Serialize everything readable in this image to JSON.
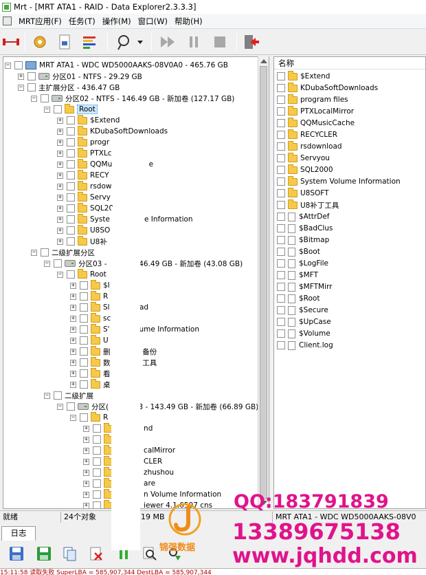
{
  "window": {
    "title": "Mrt - [MRT ATA1 - RAID - Data Explorer2.3.3.3]"
  },
  "menu": [
    {
      "name": "menu-mrt-app",
      "label": "MRT应用(F)"
    },
    {
      "name": "menu-task",
      "label": "任务(T)"
    },
    {
      "name": "menu-action",
      "label": "操作(M)"
    },
    {
      "name": "menu-window",
      "label": "窗口(W)"
    },
    {
      "name": "menu-help",
      "label": "帮助(H)"
    }
  ],
  "tree": [
    {
      "level": 0,
      "exp": "−",
      "icon": "pc",
      "label": "MRT ATA1 - WDC WD5000AAKS-08V0A0 - 465.76 GB"
    },
    {
      "level": 1,
      "exp": "+",
      "icon": "disk",
      "label": "分区01 - NTFS - 29.29 GB"
    },
    {
      "level": 1,
      "exp": "−",
      "icon": "none",
      "label": "主扩展分区 - 436.47 GB"
    },
    {
      "level": 2,
      "exp": "−",
      "icon": "disk",
      "label": "分区02 - NTFS - 146.49 GB - 新加卷 (127.17 GB)"
    },
    {
      "level": 3,
      "exp": "−",
      "icon": "folder",
      "label": "Root",
      "selected": true
    },
    {
      "level": 4,
      "exp": "+",
      "icon": "folder",
      "label": "$Extend"
    },
    {
      "level": 4,
      "exp": "+",
      "icon": "folder",
      "label": "KDubaSoftDownloads"
    },
    {
      "level": 4,
      "exp": "+",
      "icon": "folder",
      "label": "progr"
    },
    {
      "level": 4,
      "exp": "+",
      "icon": "folder",
      "label": "PTXLc"
    },
    {
      "level": 4,
      "exp": "+",
      "icon": "folder",
      "label": "QQMu                e"
    },
    {
      "level": 4,
      "exp": "+",
      "icon": "folder",
      "label": "RECY"
    },
    {
      "level": 4,
      "exp": "+",
      "icon": "folder",
      "label": "rsdow"
    },
    {
      "level": 4,
      "exp": "+",
      "icon": "folder",
      "label": "Servy"
    },
    {
      "level": 4,
      "exp": "+",
      "icon": "folder",
      "label": "SQL20"
    },
    {
      "level": 4,
      "exp": "+",
      "icon": "folder",
      "label": "Syste               e Information"
    },
    {
      "level": 4,
      "exp": "+",
      "icon": "folder",
      "label": "U8SO"
    },
    {
      "level": 4,
      "exp": "+",
      "icon": "folder",
      "label": "U8补"
    },
    {
      "level": 2,
      "exp": "−",
      "icon": "none",
      "label": "二级扩展分区"
    },
    {
      "level": 3,
      "exp": "−",
      "icon": "disk",
      "label": "分区03 -              46.49 GB - 新加卷 (43.08 GB)"
    },
    {
      "level": 4,
      "exp": "−",
      "icon": "folder",
      "label": "Root"
    },
    {
      "level": 5,
      "exp": "+",
      "icon": "folder",
      "label": "$I"
    },
    {
      "level": 5,
      "exp": "+",
      "icon": "folder",
      "label": "R"
    },
    {
      "level": 5,
      "exp": "+",
      "icon": "folder",
      "label": "Sl             ad"
    },
    {
      "level": 5,
      "exp": "+",
      "icon": "folder",
      "label": "sc"
    },
    {
      "level": 5,
      "exp": "+",
      "icon": "folder",
      "label": "S'            lume Information"
    },
    {
      "level": 5,
      "exp": "+",
      "icon": "folder",
      "label": "U"
    },
    {
      "level": 5,
      "exp": "+",
      "icon": "folder",
      "label": "删              备份"
    },
    {
      "level": 5,
      "exp": "+",
      "icon": "folder",
      "label": "数              工具"
    },
    {
      "level": 5,
      "exp": "+",
      "icon": "folder",
      "label": "看"
    },
    {
      "level": 5,
      "exp": "+",
      "icon": "folder",
      "label": "桌"
    },
    {
      "level": 3,
      "exp": "−",
      "icon": "none",
      "label": "二级扩展"
    },
    {
      "level": 4,
      "exp": "−",
      "icon": "disk",
      "label": "分区(             3 - 143.49 GB - 新加卷 (66.89 GB)"
    },
    {
      "level": 5,
      "exp": "−",
      "icon": "folder",
      "label": "R"
    },
    {
      "level": 6,
      "exp": "+",
      "icon": "folder",
      "label": "            nd"
    },
    {
      "level": 6,
      "exp": "+",
      "icon": "folder",
      "label": ""
    },
    {
      "level": 6,
      "exp": "+",
      "icon": "folder",
      "label": "            calMirror"
    },
    {
      "level": 6,
      "exp": "+",
      "icon": "folder",
      "label": "            CLER"
    },
    {
      "level": 6,
      "exp": "+",
      "icon": "folder",
      "label": "            zhushou"
    },
    {
      "level": 6,
      "exp": "+",
      "icon": "folder",
      "label": "            are"
    },
    {
      "level": 6,
      "exp": "+",
      "icon": "folder",
      "label": "            n Volume Information"
    },
    {
      "level": 6,
      "exp": "+",
      "icon": "folder",
      "label": "            iewer 4.1.6507 cns"
    }
  ],
  "list": {
    "header": "名称",
    "items": [
      {
        "icon": "folder",
        "label": "$Extend"
      },
      {
        "icon": "folder",
        "label": "KDubaSoftDownloads"
      },
      {
        "icon": "folder",
        "label": "program files"
      },
      {
        "icon": "folder",
        "label": "PTXLocalMirror"
      },
      {
        "icon": "folder",
        "label": "QQMusicCache"
      },
      {
        "icon": "folder",
        "label": "RECYCLER"
      },
      {
        "icon": "folder",
        "label": "rsdownload"
      },
      {
        "icon": "folder",
        "label": "Servyou"
      },
      {
        "icon": "folder",
        "label": "SQL2000"
      },
      {
        "icon": "folder",
        "label": "System Volume Information"
      },
      {
        "icon": "folder",
        "label": "U8SOFT"
      },
      {
        "icon": "folder",
        "label": "U8补丁工具"
      },
      {
        "icon": "file",
        "label": "$AttrDef"
      },
      {
        "icon": "file",
        "label": "$BadClus"
      },
      {
        "icon": "file",
        "label": "$Bitmap"
      },
      {
        "icon": "file",
        "label": "$Boot"
      },
      {
        "icon": "file",
        "label": "$LogFile"
      },
      {
        "icon": "file",
        "label": "$MFT"
      },
      {
        "icon": "file",
        "label": "$MFTMirr"
      },
      {
        "icon": "file",
        "label": "$Root"
      },
      {
        "icon": "file",
        "label": "$Secure"
      },
      {
        "icon": "file",
        "label": "$UpCase"
      },
      {
        "icon": "file",
        "label": "$Volume"
      },
      {
        "icon": "file",
        "label": "Client.log"
      }
    ]
  },
  "status": {
    "ready": "就绪",
    "count": "24个对象",
    "size": "19 MB",
    "device": "MRT ATA1 - WDC WD5000AAKS-08V0"
  },
  "log": {
    "tab": "日志",
    "line": "15:11:58    读取失败        SuperLBA = 585,907,344        DestLBA =    585,907,344"
  },
  "watermark": {
    "qq": "QQ:183791839",
    "phone": "13389675138",
    "url": "www.jqhdd.com",
    "brand": "锦强数据"
  },
  "colors": {
    "watermark": "#e0138c",
    "selection": "#cce8ff",
    "folder": "#f5c94a"
  }
}
